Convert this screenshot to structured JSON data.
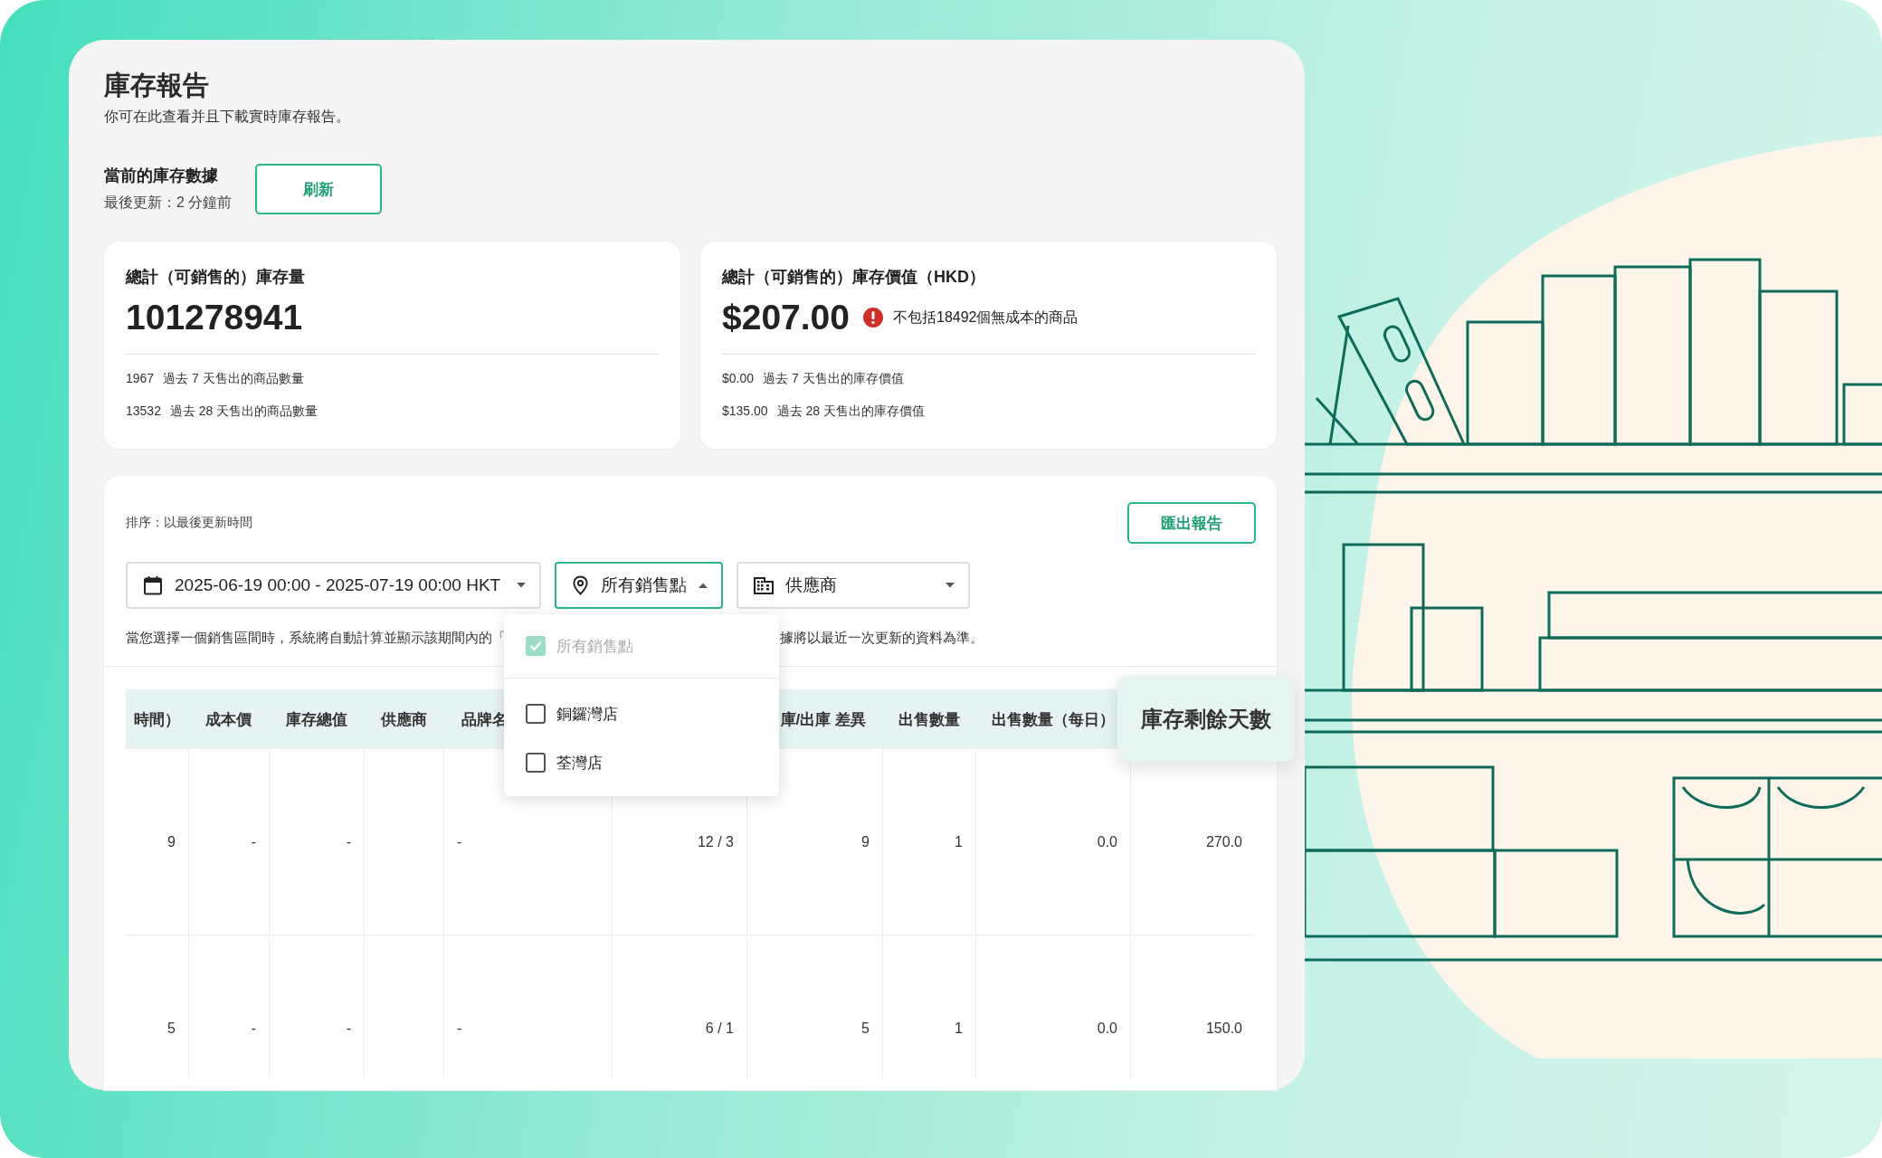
{
  "page": {
    "title": "庫存報告",
    "subtitle": "你可在此查看并且下載實時庫存報告。"
  },
  "current": {
    "label": "當前的庫存數據",
    "updated": "最後更新：2 分鐘前",
    "button": "刷新"
  },
  "stats": [
    {
      "title": "總計（可銷售的）庫存量",
      "value": "101278941",
      "lines": [
        {
          "value": "1967",
          "label": "過去 7 天售出的商品數量"
        },
        {
          "value": "13532",
          "label": "過去 28 天售出的商品數量"
        }
      ]
    },
    {
      "title": "總計（可銷售的）庫存價值（HKD）",
      "value": "$207.00",
      "warning": "不包括18492個無成本的商品",
      "lines": [
        {
          "value": "$0.00",
          "label": "過去 7 天售出的庫存價值"
        },
        {
          "value": "$135.00",
          "label": "過去 28 天售出的庫存價值"
        }
      ]
    }
  ],
  "report": {
    "sort": "排序：以最後更新時間",
    "export_button": "匯出報告",
    "filters": [
      {
        "kind": "date",
        "value": "2025-06-19 00:00 - 2025-07-19 00:00  HKT",
        "open": false
      },
      {
        "kind": "location",
        "value": "所有銷售點",
        "open": true
      },
      {
        "kind": "supplier",
        "value": "供應商",
        "open": false
      }
    ],
    "location_menu": [
      {
        "label": "所有銷售點",
        "checked": true,
        "disabled": true
      },
      {
        "label": "銅鑼灣店",
        "checked": false,
        "disabled": false
      },
      {
        "label": "荃灣店",
        "checked": false,
        "disabled": false
      }
    ],
    "note": [
      "當您選擇一個銷售區間時，系統將自動計算並顯示該期間內的「",
      "據將以最近一次更新的資料為準。"
    ],
    "columns": [
      "時間）",
      "成本價",
      "庫存總值",
      "供應商",
      "品牌名",
      "",
      "庫/出庫 差異",
      "出售數量",
      "出售數量（每日）",
      "庫存剩餘天數"
    ],
    "rows": [
      [
        "9",
        "-",
        "-",
        "",
        "-",
        "12 / 3",
        "9",
        "1",
        "0.0",
        "270.0"
      ],
      [
        "5",
        "-",
        "-",
        "",
        "-",
        "6 / 1",
        "5",
        "1",
        "0.0",
        "150.0"
      ]
    ]
  }
}
